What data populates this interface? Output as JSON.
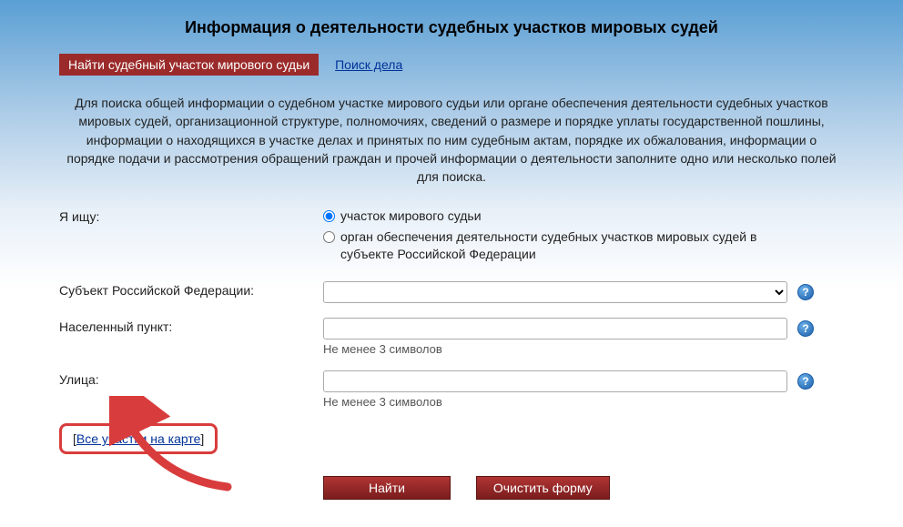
{
  "header": {
    "title": "Информация о деятельности судебных участков мировых судей"
  },
  "tabs": {
    "active": "Найти судебный участок мирового судьи",
    "link": "Поиск дела"
  },
  "description": "Для поиска общей информации о судебном участке мирового судьи или органе обеспечения деятельности судебных участков мировых судей, организационной структуре, полномочиях, сведений о размере и порядке уплаты государственной пошлины, информации о находящихся в участке делах и принятых по ним судебным актам, порядке их обжалования, информации о порядке подачи и рассмотрения обращений граждан и прочей информации о деятельности заполните одно или несколько полей для поиска.",
  "form": {
    "searching_label": "Я ищу:",
    "radio1": "участок мирового судьи",
    "radio2": "орган обеспечения деятельности судебных участков мировых судей в субъекте Российской Федерации",
    "subject_label": "Субъект Российской Федерации:",
    "locality_label": "Населенный пункт:",
    "street_label": "Улица:",
    "min_chars_hint": "Не менее 3 символов",
    "map_link_prefix": "[",
    "map_link_text": "Все участки на карте",
    "map_link_suffix": "]",
    "find_button": "Найти",
    "clear_button": "Очистить форму"
  }
}
